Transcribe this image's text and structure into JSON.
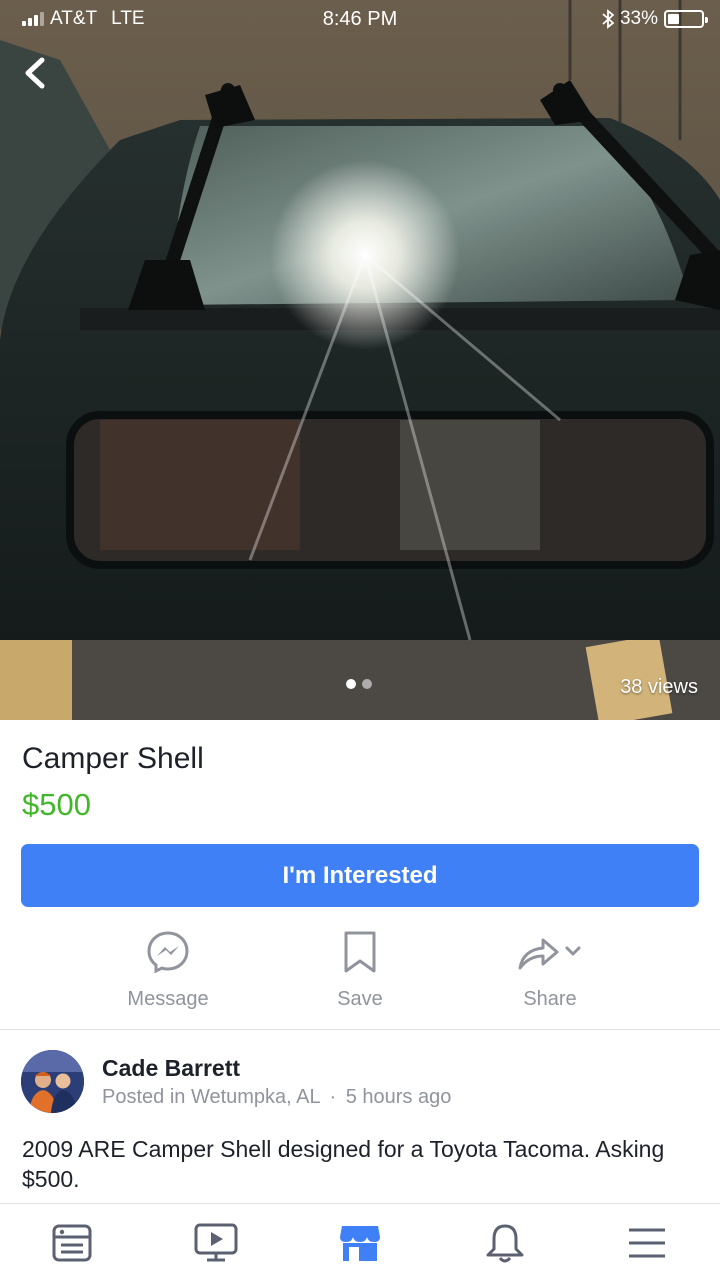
{
  "status_bar": {
    "carrier": "AT&T",
    "network": "LTE",
    "time": "8:46 PM",
    "battery": "33%",
    "battery_level": 0.33
  },
  "photo": {
    "views": "38 views",
    "page_count": 2,
    "current_page": 1
  },
  "listing": {
    "title": "Camper Shell",
    "price": "$500",
    "interested_label": "I'm Interested"
  },
  "actions": {
    "message": "Message",
    "save": "Save",
    "share": "Share"
  },
  "seller": {
    "name": "Cade Barrett",
    "location": "Posted in Wetumpka, AL",
    "separator": "·",
    "time": "5 hours ago"
  },
  "description": "2009 ARE Camper Shell designed for a Toyota Tacoma. Asking $500.",
  "colors": {
    "accent": "#4080f7",
    "price": "#42b72a",
    "tab_active": "#4080f7",
    "muted": "#90949c"
  },
  "tabs": [
    {
      "icon": "news-feed-icon",
      "active": false
    },
    {
      "icon": "watch-video-icon",
      "active": false
    },
    {
      "icon": "marketplace-icon",
      "active": true
    },
    {
      "icon": "notifications-bell-icon",
      "active": false
    },
    {
      "icon": "menu-icon",
      "active": false
    }
  ]
}
